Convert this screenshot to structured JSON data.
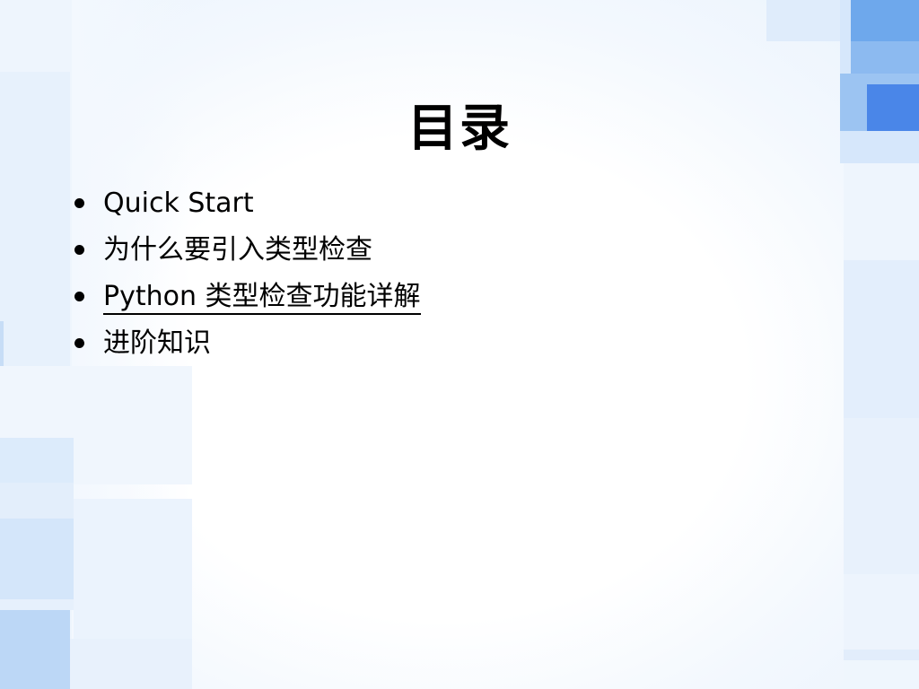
{
  "slide": {
    "title": "目录",
    "items": [
      {
        "label": "Quick Start",
        "underlined": false
      },
      {
        "label": "为什么要引入类型检查",
        "underlined": false
      },
      {
        "label": "Python 类型检查功能详解",
        "underlined": true
      },
      {
        "label": "进阶知识",
        "underlined": false
      }
    ]
  },
  "theme": {
    "text_color": "#000000",
    "accent_blue": "#4a86e8",
    "light_blue": "#d6e7f9"
  }
}
